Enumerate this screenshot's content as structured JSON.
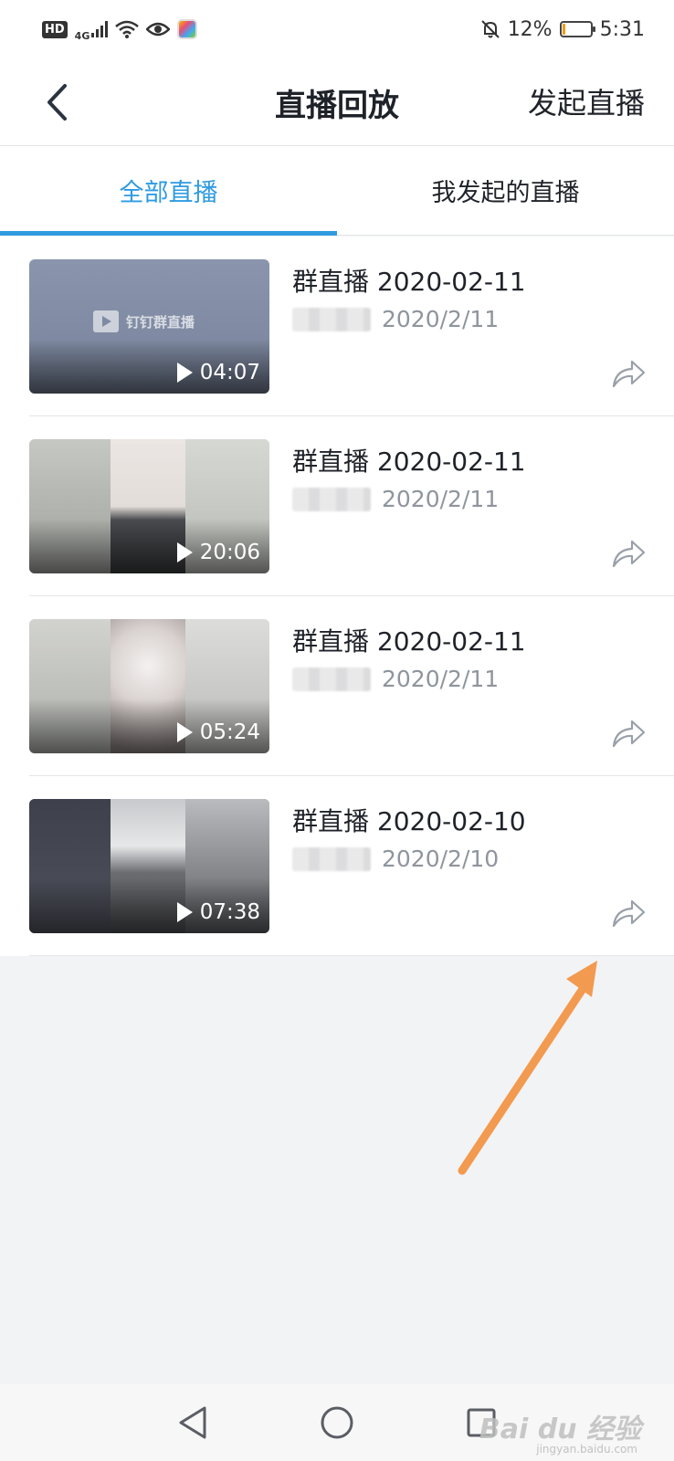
{
  "status_bar": {
    "network_badge": "HD",
    "network_type": "4G",
    "battery_percent": "12%",
    "battery_level": 0.12,
    "time": "5:31"
  },
  "header": {
    "back_icon": "chevron-left-icon",
    "title": "直播回放",
    "action_label": "发起直播"
  },
  "tabs": [
    {
      "label": "全部直播",
      "active": true
    },
    {
      "label": "我发起的直播",
      "active": false
    }
  ],
  "items": [
    {
      "title": "群直播 2020-02-11",
      "date": "2020/2/11",
      "duration": "04:07",
      "watermark": "钉钉群直播"
    },
    {
      "title": "群直播 2020-02-11",
      "date": "2020/2/11",
      "duration": "20:06"
    },
    {
      "title": "群直播 2020-02-11",
      "date": "2020/2/11",
      "duration": "05:24"
    },
    {
      "title": "群直播 2020-02-10",
      "date": "2020/2/10",
      "duration": "07:38"
    }
  ],
  "colors": {
    "accent": "#2f9be0",
    "annotation_arrow": "#f29a50",
    "secondary_text": "#8f959e"
  },
  "nav_bar": {
    "icons": [
      "back-triangle-icon",
      "home-circle-icon",
      "recents-square-icon"
    ]
  },
  "watermark": {
    "brand": "Bai du 经验",
    "url": "jingyan.baidu.com"
  }
}
